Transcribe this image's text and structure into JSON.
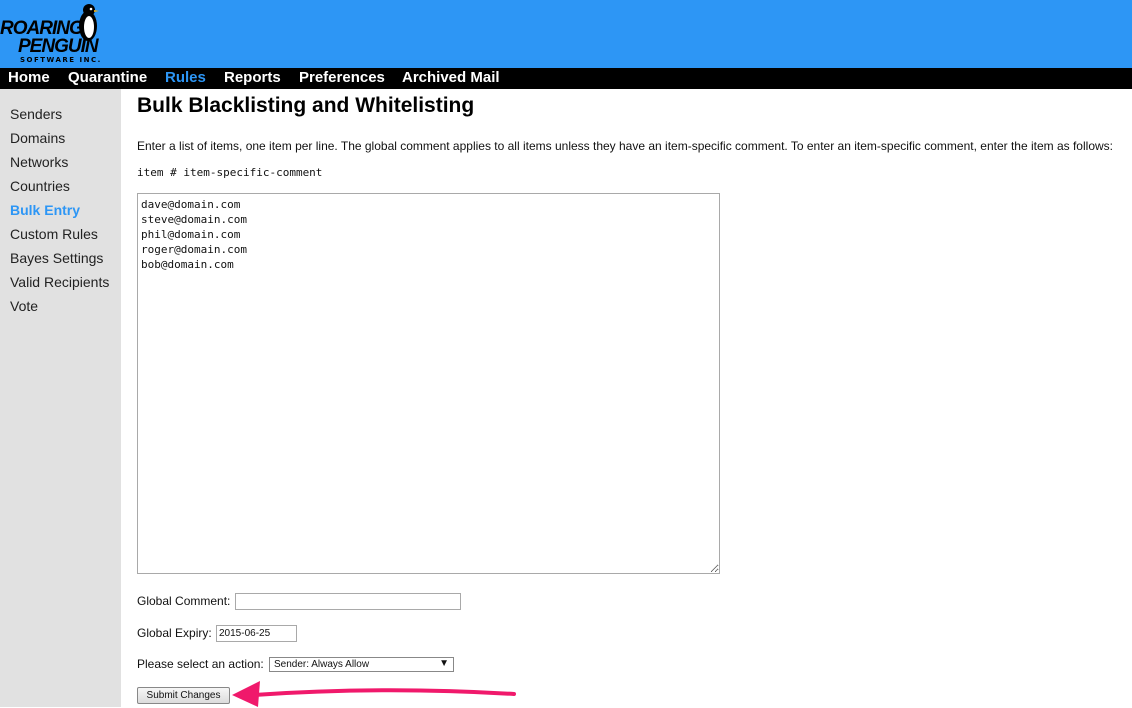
{
  "brand": {
    "line1": "ROARING",
    "line2": "PENGUIN",
    "line3": "SOFTWARE INC."
  },
  "nav": {
    "items": [
      {
        "label": "Home",
        "active": false
      },
      {
        "label": "Quarantine",
        "active": false
      },
      {
        "label": "Rules",
        "active": true
      },
      {
        "label": "Reports",
        "active": false
      },
      {
        "label": "Preferences",
        "active": false
      },
      {
        "label": "Archived Mail",
        "active": false
      }
    ]
  },
  "sidebar": {
    "items": [
      {
        "label": "Senders",
        "active": false
      },
      {
        "label": "Domains",
        "active": false
      },
      {
        "label": "Networks",
        "active": false
      },
      {
        "label": "Countries",
        "active": false
      },
      {
        "label": "Bulk Entry",
        "active": true
      },
      {
        "label": "Custom Rules",
        "active": false
      },
      {
        "label": "Bayes Settings",
        "active": false
      },
      {
        "label": "Valid Recipients",
        "active": false
      },
      {
        "label": "Vote",
        "active": false
      }
    ]
  },
  "main": {
    "title": "Bulk Blacklisting and Whitelisting",
    "description": "Enter a list of items, one item per line. The global comment applies to all items unless they have an item-specific comment. To enter an item-specific comment, enter the item as follows:",
    "format_example": "item # item-specific-comment",
    "items_text": "dave@domain.com\nsteve@domain.com\nphil@domain.com\nroger@domain.com\nbob@domain.com",
    "global_comment_label": "Global Comment:",
    "global_comment_value": "",
    "global_expiry_label": "Global Expiry:",
    "global_expiry_value": "2015-06-25",
    "action_label": "Please select an action:",
    "action_selected": "Sender: Always Allow",
    "submit_label": "Submit Changes"
  },
  "colors": {
    "header_bg": "#2d96f5",
    "nav_bg": "#000000",
    "active_link": "#2d96f5",
    "sidebar_bg": "#e1e1e1",
    "annotation_arrow": "#f0196b"
  }
}
